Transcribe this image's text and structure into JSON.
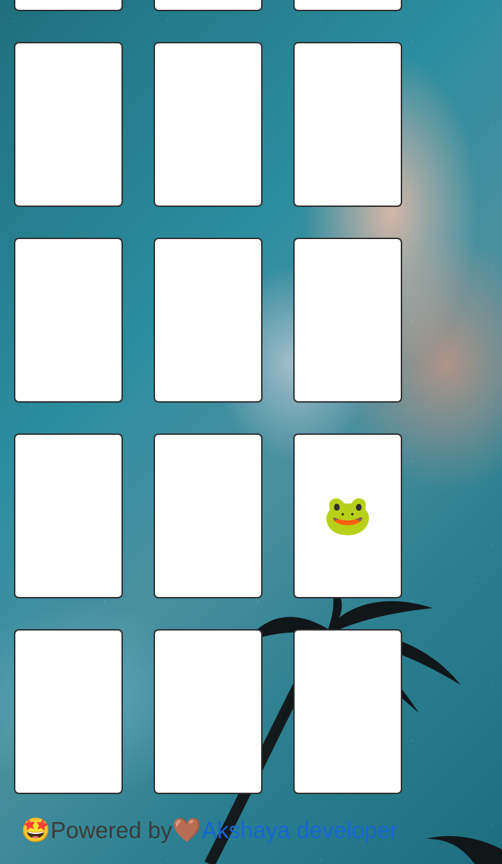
{
  "cards": [
    {
      "face": ""
    },
    {
      "face": ""
    },
    {
      "face": ""
    },
    {
      "face": ""
    },
    {
      "face": ""
    },
    {
      "face": ""
    },
    {
      "face": ""
    },
    {
      "face": ""
    },
    {
      "face": ""
    },
    {
      "face": ""
    },
    {
      "face": ""
    },
    {
      "face": "🐸"
    },
    {
      "face": ""
    },
    {
      "face": ""
    },
    {
      "face": ""
    }
  ],
  "footer": {
    "star_emoji": "🤩",
    "powered_by": "Powered by ",
    "heart_emoji": "🤎",
    "developer": "Akshaya developer"
  },
  "colors": {
    "card_background": "#ffffff",
    "card_border": "#2f2f2f",
    "link": "#1565d8",
    "footer_text": "#3b3b3b"
  }
}
